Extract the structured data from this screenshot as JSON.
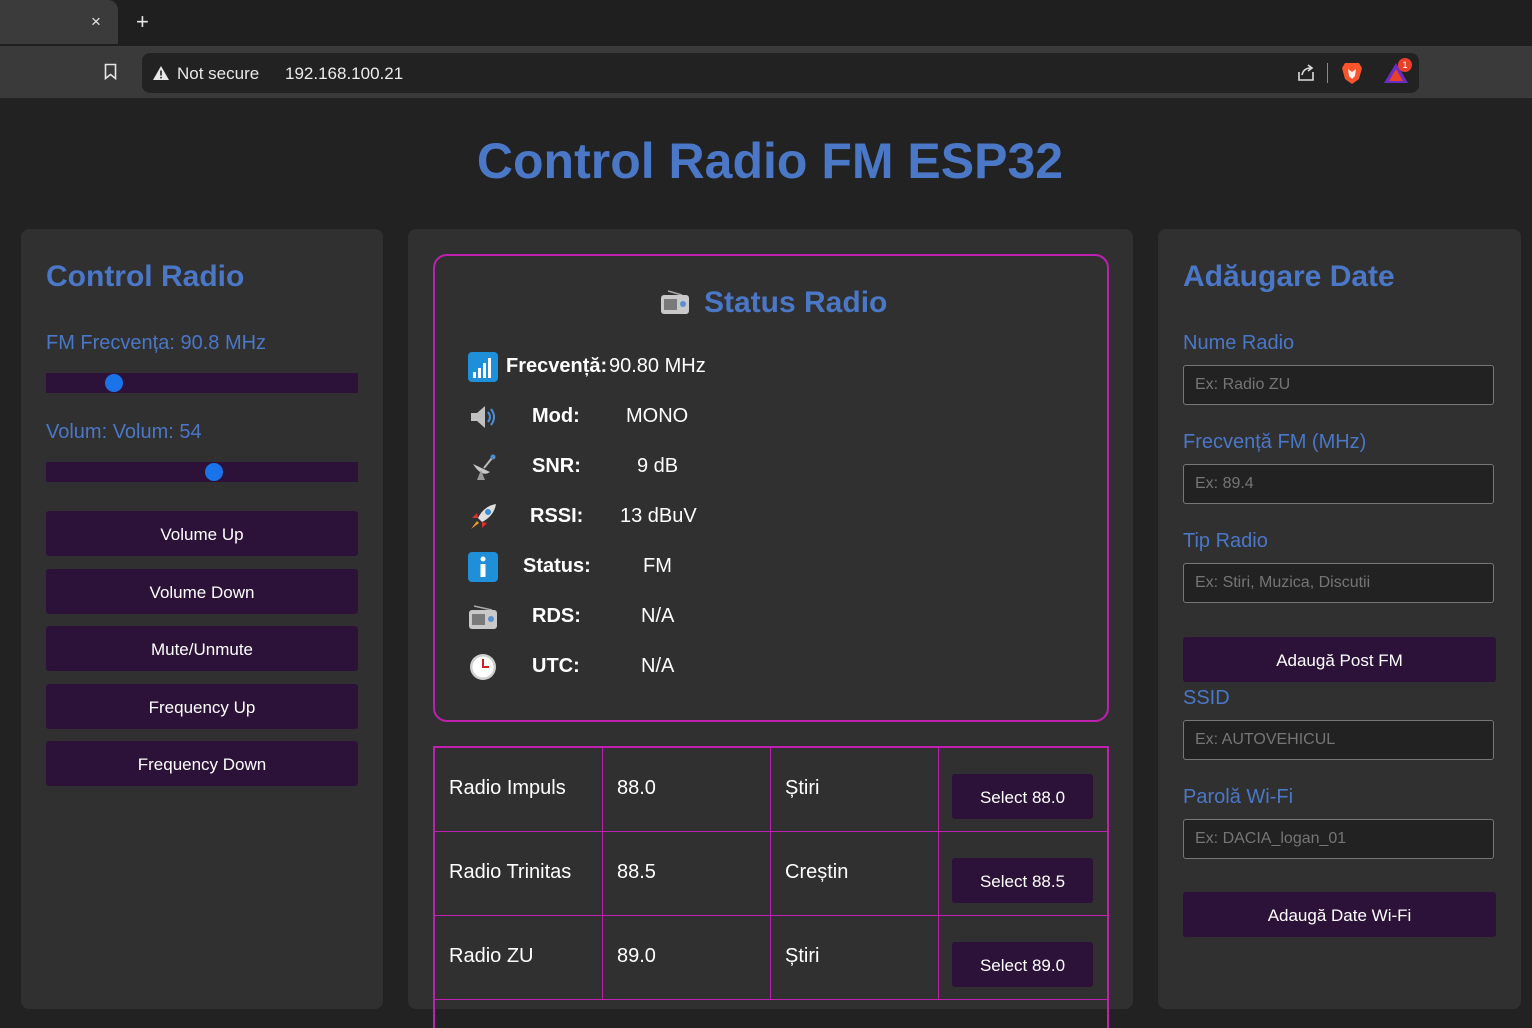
{
  "browser": {
    "tab_close": "×",
    "new_tab": "+",
    "security_label": "Not secure",
    "url": "192.168.100.21",
    "badge_count": "1"
  },
  "page": {
    "title": "Control Radio FM ESP32"
  },
  "control": {
    "heading": "Control Radio",
    "freq_label": "FM Frecvența: 90.8 MHz",
    "freq_value": 90.8,
    "freq_fraction": 0.2,
    "volume_label": "Volum: Volum: 54",
    "volume_value": 54,
    "volume_fraction": 0.54,
    "buttons": {
      "volume_up": "Volume Up",
      "volume_down": "Volume Down",
      "mute": "Mute/Unmute",
      "freq_up": "Frequency Up",
      "freq_down": "Frequency Down"
    }
  },
  "status": {
    "heading": "Status Radio",
    "rows": {
      "frequency": {
        "key": "Frecvență:",
        "value": "90.80 MHz",
        "icon": "signal-bars-icon"
      },
      "mode": {
        "key": "Mod:",
        "value": "MONO",
        "icon": "speaker-icon"
      },
      "snr": {
        "key": "SNR:",
        "value": "9 dB",
        "icon": "satellite-icon"
      },
      "rssi": {
        "key": "RSSI:",
        "value": "13 dBuV",
        "icon": "rocket-icon"
      },
      "state": {
        "key": "Status:",
        "value": "FM",
        "icon": "info-icon"
      },
      "rds": {
        "key": "RDS:",
        "value": "N/A",
        "icon": "radio-icon"
      },
      "utc": {
        "key": "UTC:",
        "value": "N/A",
        "icon": "clock-icon"
      }
    }
  },
  "stations": [
    {
      "name": "Radio Impuls",
      "freq": "88.0",
      "type": "Știri",
      "button": "Select 88.0"
    },
    {
      "name": "Radio Trinitas",
      "freq": "88.5",
      "type": "Creștin",
      "button": "Select 88.5"
    },
    {
      "name": "Radio ZU",
      "freq": "89.0",
      "type": "Știri",
      "button": "Select 89.0"
    }
  ],
  "add": {
    "heading": "Adăugare Date",
    "name_label": "Nume Radio",
    "name_placeholder": "Ex: Radio ZU",
    "freq_label": "Frecvență FM (MHz)",
    "freq_placeholder": "Ex: 89.4",
    "type_label": "Tip Radio",
    "type_placeholder": "Ex: Stiri, Muzica, Discutii",
    "add_station_button": "Adaugă Post FM",
    "ssid_label": "SSID",
    "ssid_placeholder": "Ex: AUTOVEHICUL",
    "password_label": "Parolă Wi-Fi",
    "password_placeholder": "Ex: DACIA_logan_01",
    "add_wifi_button": "Adaugă Date Wi-Fi"
  },
  "colors": {
    "accent": "#4b77c7",
    "button_bg": "#2c1238",
    "border": "#c020b0",
    "slider_thumb": "#1a73e8"
  }
}
